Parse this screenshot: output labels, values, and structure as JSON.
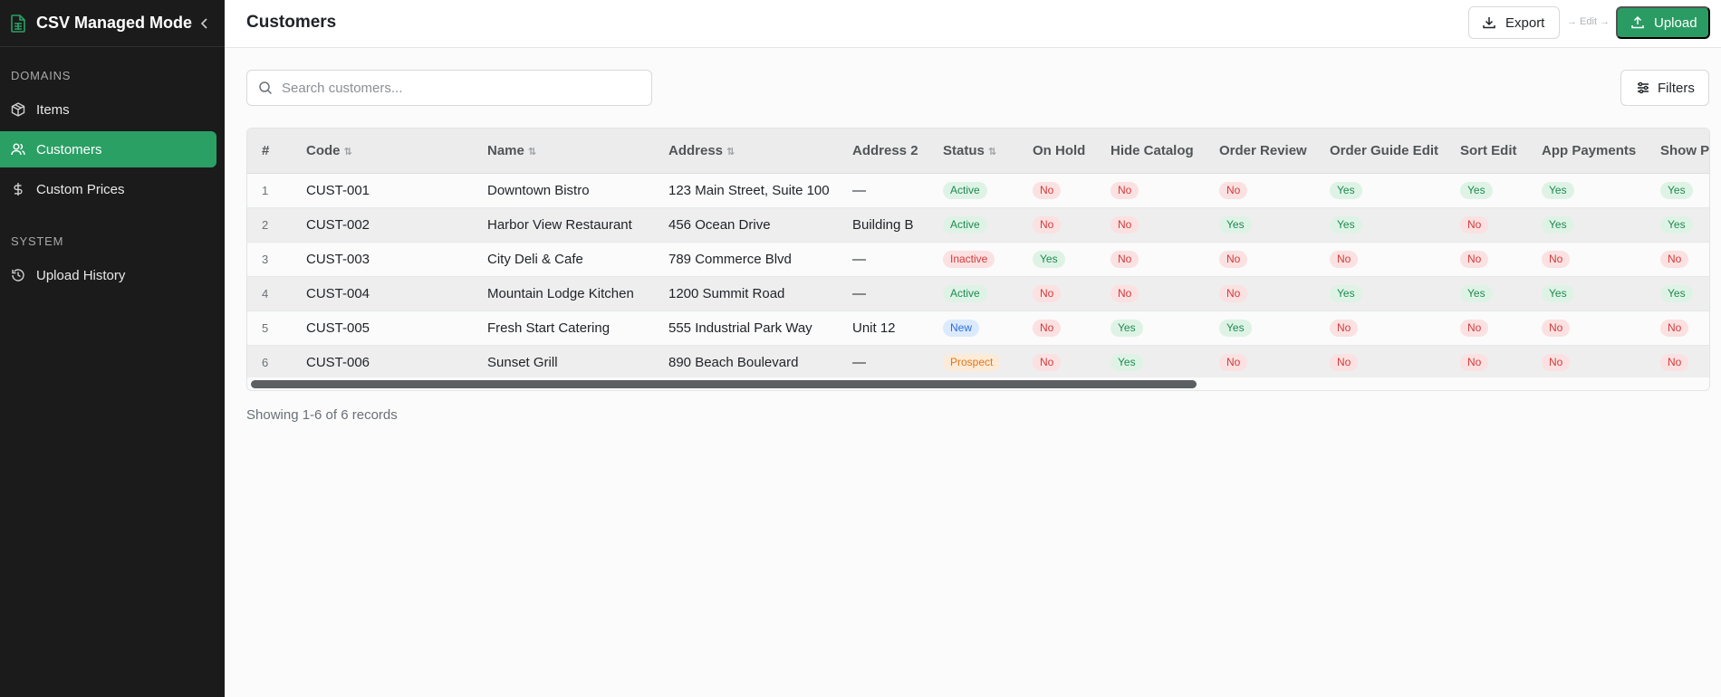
{
  "app": {
    "title": "CSV Managed Mode",
    "logo_icon": "file-spreadsheet-icon",
    "collapse_icon": "chevron-left-icon"
  },
  "sidebar": {
    "sections": [
      {
        "label": "DOMAINS",
        "items": [
          {
            "label": "Items",
            "icon": "package-icon",
            "active": false
          },
          {
            "label": "Customers",
            "icon": "users-icon",
            "active": true
          },
          {
            "label": "Custom Prices",
            "icon": "dollar-icon",
            "active": false
          }
        ]
      },
      {
        "label": "SYSTEM",
        "items": [
          {
            "label": "Upload History",
            "icon": "history-icon",
            "active": false
          }
        ]
      }
    ]
  },
  "header": {
    "title": "Customers",
    "export_label": "Export",
    "edit_hint": "→ Edit →",
    "upload_label": "Upload"
  },
  "search": {
    "placeholder": "Search customers...",
    "value": ""
  },
  "filters_label": "Filters",
  "colors": {
    "accent": "#2aa065",
    "sidebar_bg": "#1b1b1b",
    "yes_bg": "#def3e6",
    "no_bg": "#fbe1e1"
  },
  "table": {
    "columns": [
      {
        "label": "#",
        "sortable": false
      },
      {
        "label": "Code",
        "sortable": true
      },
      {
        "label": "Name",
        "sortable": true
      },
      {
        "label": "Address",
        "sortable": true
      },
      {
        "label": "Address 2",
        "sortable": false
      },
      {
        "label": "Status",
        "sortable": true
      },
      {
        "label": "On Hold",
        "sortable": false
      },
      {
        "label": "Hide Catalog",
        "sortable": false
      },
      {
        "label": "Order Review",
        "sortable": false
      },
      {
        "label": "Order Guide Edit",
        "sortable": false
      },
      {
        "label": "Sort Edit",
        "sortable": false
      },
      {
        "label": "App Payments",
        "sortable": false
      },
      {
        "label": "Show Pa",
        "sortable": false
      }
    ],
    "sort_glyph": "⇅",
    "rows": [
      {
        "num": "1",
        "code": "CUST-001",
        "name": "Downtown Bistro",
        "address": "123 Main Street, Suite 100",
        "address2": "—",
        "status": "Active",
        "on_hold": "No",
        "hide_catalog": "No",
        "order_review": "No",
        "order_guide_edit": "Yes",
        "sort_edit": "Yes",
        "app_payments": "Yes",
        "show_pa": "Yes"
      },
      {
        "num": "2",
        "code": "CUST-002",
        "name": "Harbor View Restaurant",
        "address": "456 Ocean Drive",
        "address2": "Building B",
        "status": "Active",
        "on_hold": "No",
        "hide_catalog": "No",
        "order_review": "Yes",
        "order_guide_edit": "Yes",
        "sort_edit": "No",
        "app_payments": "Yes",
        "show_pa": "Yes"
      },
      {
        "num": "3",
        "code": "CUST-003",
        "name": "City Deli & Cafe",
        "address": "789 Commerce Blvd",
        "address2": "—",
        "status": "Inactive",
        "on_hold": "Yes",
        "hide_catalog": "No",
        "order_review": "No",
        "order_guide_edit": "No",
        "sort_edit": "No",
        "app_payments": "No",
        "show_pa": "No"
      },
      {
        "num": "4",
        "code": "CUST-004",
        "name": "Mountain Lodge Kitchen",
        "address": "1200 Summit Road",
        "address2": "—",
        "status": "Active",
        "on_hold": "No",
        "hide_catalog": "No",
        "order_review": "No",
        "order_guide_edit": "Yes",
        "sort_edit": "Yes",
        "app_payments": "Yes",
        "show_pa": "Yes"
      },
      {
        "num": "5",
        "code": "CUST-005",
        "name": "Fresh Start Catering",
        "address": "555 Industrial Park Way",
        "address2": "Unit 12",
        "status": "New",
        "on_hold": "No",
        "hide_catalog": "Yes",
        "order_review": "Yes",
        "order_guide_edit": "No",
        "sort_edit": "No",
        "app_payments": "No",
        "show_pa": "No"
      },
      {
        "num": "6",
        "code": "CUST-006",
        "name": "Sunset Grill",
        "address": "890 Beach Boulevard",
        "address2": "—",
        "status": "Prospect",
        "on_hold": "No",
        "hide_catalog": "Yes",
        "order_review": "No",
        "order_guide_edit": "No",
        "sort_edit": "No",
        "app_payments": "No",
        "show_pa": "No"
      }
    ]
  },
  "pagination": {
    "summary": "Showing 1-6 of 6 records"
  }
}
